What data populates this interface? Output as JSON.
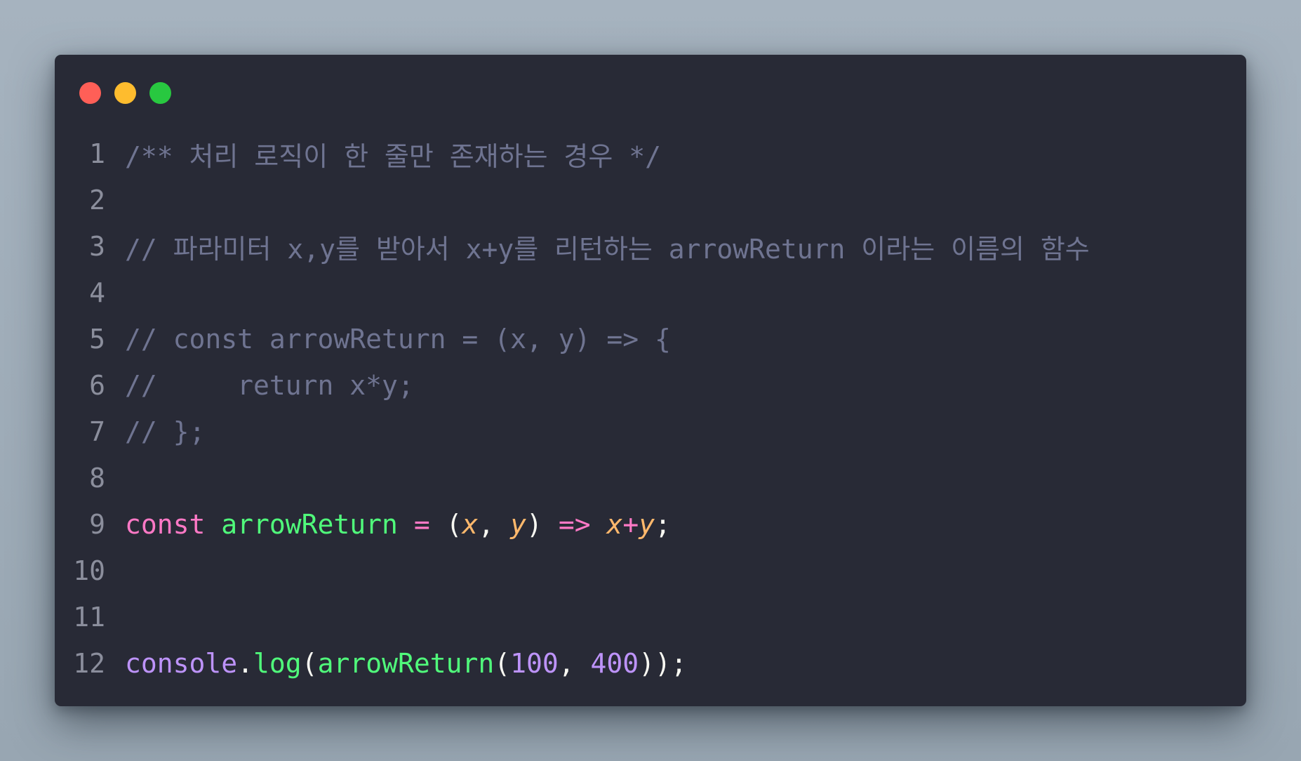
{
  "window": {
    "traffic_lights": [
      {
        "name": "close",
        "color": "#ff5f57"
      },
      {
        "name": "minimize",
        "color": "#febc2e"
      },
      {
        "name": "maximize",
        "color": "#28c840"
      }
    ]
  },
  "colors": {
    "background": "#282a36",
    "comment": "#6f7491",
    "keyword": "#ff79c6",
    "function": "#50fa7b",
    "parameter": "#ffb86c",
    "number": "#bd93f9",
    "plain": "#f8f8f2"
  },
  "code": {
    "lines": [
      {
        "number": "1",
        "tokens": [
          {
            "t": "/** 처리 로직이 한 줄만 존재하는 경우 */",
            "c": "comment"
          }
        ]
      },
      {
        "number": "2",
        "tokens": []
      },
      {
        "number": "3",
        "tokens": [
          {
            "t": "// 파라미터 x,y를 받아서 x+y를 리턴하는 arrowReturn 이라는 이름의 함수",
            "c": "comment"
          }
        ]
      },
      {
        "number": "4",
        "tokens": []
      },
      {
        "number": "5",
        "tokens": [
          {
            "t": "// const arrowReturn = (x, y) => {",
            "c": "comment"
          }
        ]
      },
      {
        "number": "6",
        "tokens": [
          {
            "t": "//     return x*y;",
            "c": "comment"
          }
        ]
      },
      {
        "number": "7",
        "tokens": [
          {
            "t": "// };",
            "c": "comment"
          }
        ]
      },
      {
        "number": "8",
        "tokens": []
      },
      {
        "number": "9",
        "tokens": [
          {
            "t": "const",
            "c": "kw"
          },
          {
            "t": " ",
            "c": "plain"
          },
          {
            "t": "arrowReturn",
            "c": "fn"
          },
          {
            "t": " ",
            "c": "plain"
          },
          {
            "t": "=",
            "c": "op"
          },
          {
            "t": " (",
            "c": "plain"
          },
          {
            "t": "x",
            "c": "param"
          },
          {
            "t": ", ",
            "c": "plain"
          },
          {
            "t": "y",
            "c": "param"
          },
          {
            "t": ") ",
            "c": "plain"
          },
          {
            "t": "=>",
            "c": "op"
          },
          {
            "t": " ",
            "c": "plain"
          },
          {
            "t": "x",
            "c": "param"
          },
          {
            "t": "+",
            "c": "op"
          },
          {
            "t": "y",
            "c": "param"
          },
          {
            "t": ";",
            "c": "plain"
          }
        ]
      },
      {
        "number": "10",
        "tokens": []
      },
      {
        "number": "11",
        "tokens": []
      },
      {
        "number": "12",
        "tokens": [
          {
            "t": "console",
            "c": "obj"
          },
          {
            "t": ".",
            "c": "plain"
          },
          {
            "t": "log",
            "c": "fn"
          },
          {
            "t": "(",
            "c": "plain"
          },
          {
            "t": "arrowReturn",
            "c": "fn"
          },
          {
            "t": "(",
            "c": "plain"
          },
          {
            "t": "100",
            "c": "num"
          },
          {
            "t": ", ",
            "c": "plain"
          },
          {
            "t": "400",
            "c": "num"
          },
          {
            "t": "));",
            "c": "plain"
          }
        ]
      }
    ]
  }
}
